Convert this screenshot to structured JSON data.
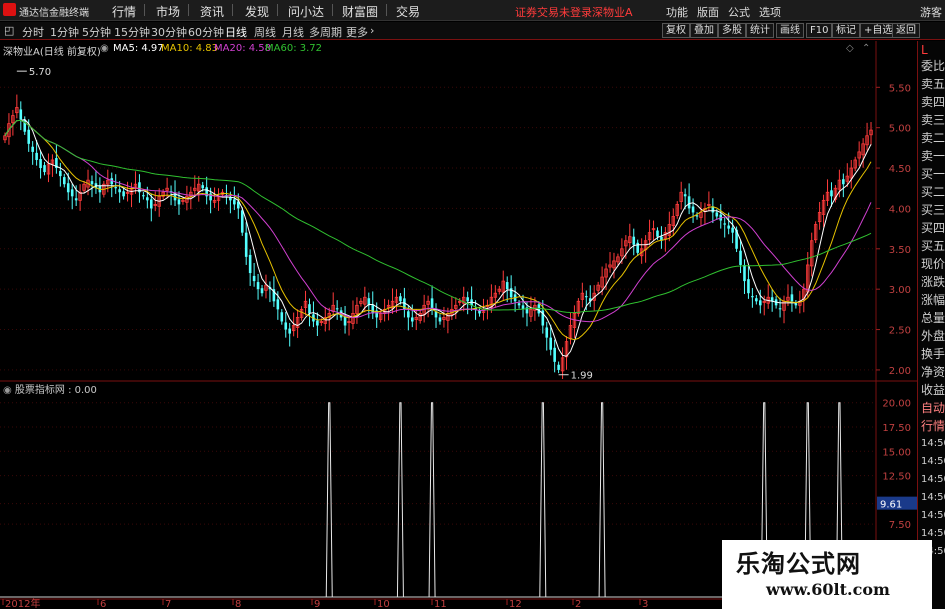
{
  "app": {
    "title": "通达信金融终端"
  },
  "menu": [
    "行情",
    "市场",
    "资讯",
    "发现",
    "问小达",
    "财富圈",
    "交易"
  ],
  "notice": "证券交易未登录",
  "stock_name_top": "深物业A",
  "right_menu": [
    "功能",
    "版面",
    "公式",
    "选项",
    "游客"
  ],
  "periods": [
    "分时",
    "1分钟",
    "5分钟",
    "15分钟",
    "30分钟",
    "60分钟",
    "日线",
    "周线",
    "月线",
    "多周期",
    "更多"
  ],
  "active_period": "日线",
  "tool_buttons": [
    "复权",
    "叠加",
    "多股",
    "统计",
    "画线",
    "F10",
    "标记",
    "+自选",
    "返回"
  ],
  "legend": {
    "stock": "深物业A(日线 前复权)",
    "ma5": "MA5: 4.97",
    "ma10": "MA10: 4.83",
    "ma20": "MA20: 4.58",
    "ma60": "MA60: 3.72"
  },
  "price_axis": [
    "5.50",
    "5.00",
    "4.50",
    "4.00",
    "3.50",
    "3.00",
    "2.50",
    "2.00"
  ],
  "annotations": {
    "high": "5.70",
    "low": "1.99"
  },
  "sub_indicator": "股票指标网 : 0.00",
  "sub_axis": [
    "20.00",
    "17.50",
    "15.00",
    "12.50",
    "9.61",
    "7.50"
  ],
  "date_labels": [
    "2012年",
    "6",
    "7",
    "8",
    "9",
    "10",
    "11",
    "12",
    "2",
    "3"
  ],
  "right_panel": {
    "head": "L",
    "items": [
      "委比",
      "卖五",
      "卖四",
      "卖三",
      "卖二",
      "卖一",
      "买一",
      "买二",
      "买三",
      "买四",
      "买五",
      "现价",
      "涨跌",
      "涨幅",
      "总量",
      "外盘",
      "换手",
      "净资",
      "收益",
      "自动",
      "行情",
      "14:50",
      "14:50",
      "14:50",
      "14:50",
      "14:50",
      "14:50",
      "14:50"
    ]
  },
  "watermark": {
    "line1": "乐淘公式网",
    "line2": "www.60lt.com"
  },
  "chart_data": {
    "type": "line",
    "title": "深物业A(日线 前复权)",
    "ylim": [
      1.9,
      5.9
    ],
    "x_count": 215,
    "close": [
      4.9,
      5.05,
      5.15,
      5.25,
      5.1,
      4.95,
      4.8,
      4.7,
      4.6,
      4.5,
      4.45,
      4.55,
      4.6,
      4.5,
      4.4,
      4.3,
      4.2,
      4.15,
      4.1,
      4.2,
      4.3,
      4.35,
      4.3,
      4.25,
      4.2,
      4.3,
      4.35,
      4.3,
      4.25,
      4.2,
      4.15,
      4.2,
      4.25,
      4.3,
      4.2,
      4.15,
      4.1,
      4.0,
      4.05,
      4.15,
      4.2,
      4.25,
      4.2,
      4.1,
      4.05,
      4.1,
      4.15,
      4.2,
      4.25,
      4.3,
      4.25,
      4.15,
      4.1,
      4.1,
      4.15,
      4.2,
      4.15,
      4.1,
      4.05,
      4.0,
      3.7,
      3.4,
      3.2,
      3.1,
      3.0,
      2.95,
      3.05,
      3.0,
      2.85,
      2.75,
      2.6,
      2.5,
      2.45,
      2.55,
      2.65,
      2.75,
      2.85,
      2.7,
      2.6,
      2.55,
      2.6,
      2.65,
      2.7,
      2.8,
      2.75,
      2.65,
      2.55,
      2.6,
      2.7,
      2.8,
      2.85,
      2.9,
      2.8,
      2.7,
      2.65,
      2.7,
      2.75,
      2.8,
      2.85,
      2.9,
      2.85,
      2.75,
      2.65,
      2.6,
      2.65,
      2.7,
      2.8,
      2.85,
      2.75,
      2.65,
      2.6,
      2.65,
      2.7,
      2.75,
      2.8,
      2.85,
      2.9,
      2.85,
      2.8,
      2.75,
      2.7,
      2.75,
      2.8,
      2.9,
      2.95,
      3.0,
      3.1,
      3.0,
      2.9,
      2.85,
      2.8,
      2.75,
      2.7,
      2.75,
      2.8,
      2.7,
      2.55,
      2.4,
      2.25,
      2.1,
      2.0,
      2.15,
      2.35,
      2.55,
      2.7,
      2.85,
      2.95,
      2.9,
      2.85,
      2.95,
      3.05,
      3.15,
      3.25,
      3.3,
      3.35,
      3.4,
      3.5,
      3.6,
      3.65,
      3.55,
      3.45,
      3.5,
      3.6,
      3.7,
      3.75,
      3.65,
      3.6,
      3.7,
      3.8,
      3.9,
      4.05,
      4.2,
      4.15,
      4.0,
      3.95,
      3.9,
      3.95,
      4.0,
      4.05,
      3.95,
      3.9,
      3.85,
      3.8,
      3.75,
      3.7,
      3.5,
      3.3,
      3.1,
      2.95,
      2.9,
      2.85,
      2.8,
      2.85,
      2.9,
      2.85,
      2.8,
      2.75,
      2.85,
      2.9,
      2.85,
      2.8,
      2.85,
      3.0,
      3.3,
      3.6,
      3.8,
      3.95,
      4.1,
      4.2,
      4.15,
      4.25,
      4.35,
      4.3,
      4.4,
      4.5,
      4.6,
      4.7,
      4.8,
      4.9,
      4.97
    ],
    "series": [
      {
        "name": "MA5",
        "value": 4.97,
        "color": "#ffffff"
      },
      {
        "name": "MA10",
        "value": 4.83,
        "color": "#e6c200"
      },
      {
        "name": "MA20",
        "value": 4.58,
        "color": "#d040d0"
      },
      {
        "name": "MA60",
        "value": 3.72,
        "color": "#30c030"
      }
    ],
    "sub_signal": {
      "name": "股票指标网",
      "ylim": [
        0,
        21
      ],
      "spike_indices": [
        82,
        100,
        108,
        136,
        151,
        192,
        203,
        211
      ],
      "spike_value": 20.0
    }
  }
}
